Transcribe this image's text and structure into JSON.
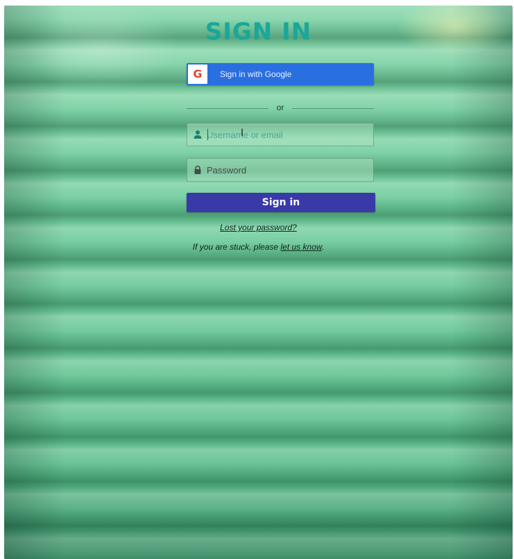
{
  "page": {
    "title": "SIGN IN"
  },
  "google_signin": {
    "badge_letter": "G",
    "label": "Sign in with Google",
    "icon": "google-g-icon"
  },
  "divider": {
    "label": "or"
  },
  "username_field": {
    "icon": "user-icon",
    "placeholder": "Username or email",
    "value": ""
  },
  "password_field": {
    "icon": "lock-icon",
    "placeholder": "Password",
    "value": ""
  },
  "signin_button": {
    "label": "Sign in"
  },
  "lost_password": {
    "label": "Lost your password?"
  },
  "help": {
    "prefix": "If you are stuck, please ",
    "link": "let us know",
    "suffix": "."
  },
  "colors": {
    "title": "#1aa79a",
    "google_button": "#2a6fe0",
    "signin_button": "#3a39a8",
    "background": "#6ccb9a"
  }
}
